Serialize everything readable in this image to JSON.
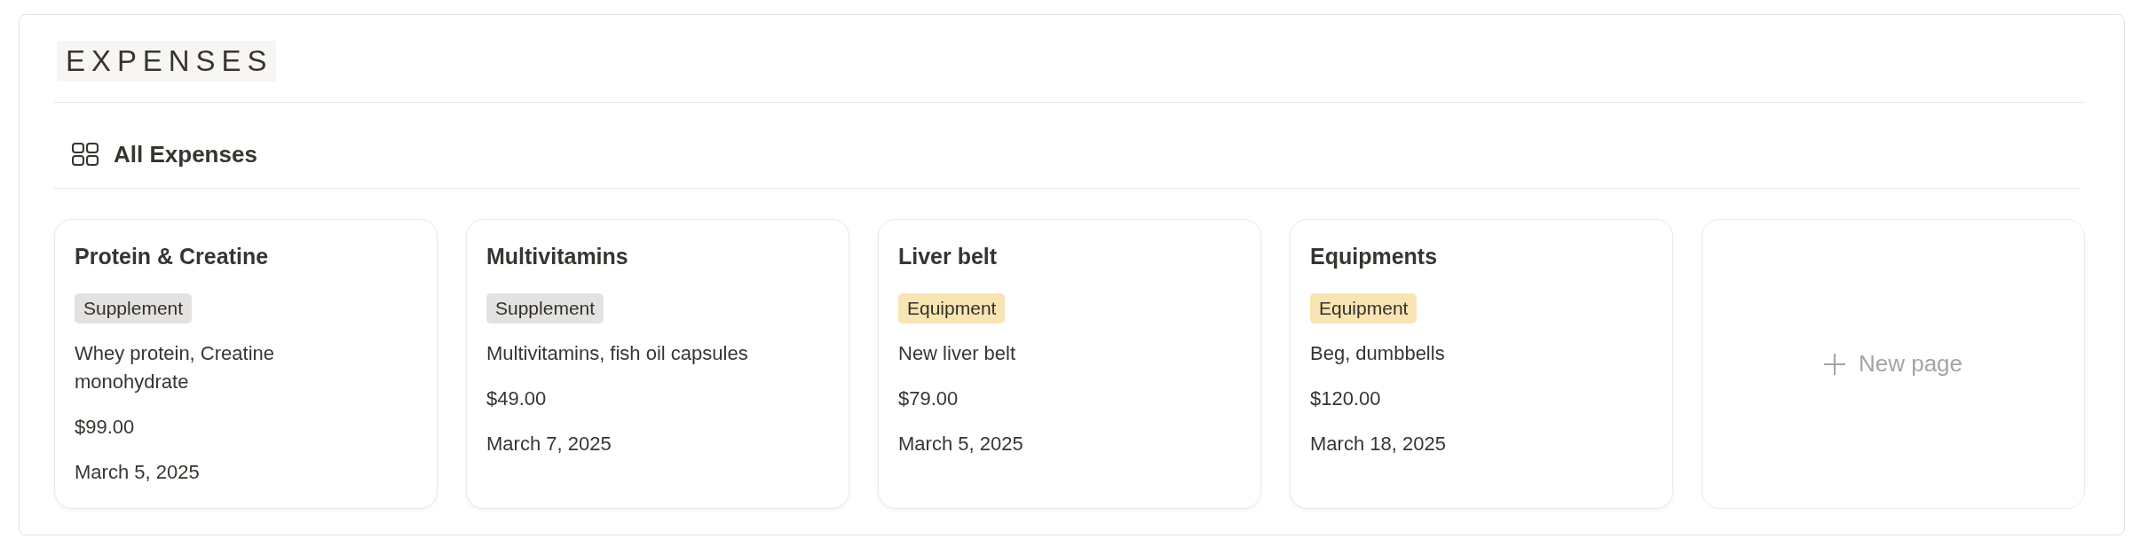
{
  "page": {
    "title": "EXPENSES"
  },
  "view": {
    "name": "All Expenses"
  },
  "cards": [
    {
      "title": "Protein & Creatine",
      "tag": {
        "label": "Supplement",
        "color": "#e3e2e0"
      },
      "description": "Whey protein, Creatine monohydrate",
      "price": "$99.00",
      "date": "March 5, 2025"
    },
    {
      "title": "Multivitamins",
      "tag": {
        "label": "Supplement",
        "color": "#e3e2e0"
      },
      "description": "Multivitamins, fish oil capsules",
      "price": "$49.00",
      "date": "March 7, 2025"
    },
    {
      "title": "Liver belt",
      "tag": {
        "label": "Equipment",
        "color": "#f9e4b3"
      },
      "description": "New liver belt",
      "price": "$79.00",
      "date": "March 5, 2025"
    },
    {
      "title": "Equipments",
      "tag": {
        "label": "Equipment",
        "color": "#f9e4b3"
      },
      "description": "Beg, dumbbells",
      "price": "$120.00",
      "date": "March 18, 2025"
    }
  ],
  "new_page": {
    "label": "New page"
  }
}
